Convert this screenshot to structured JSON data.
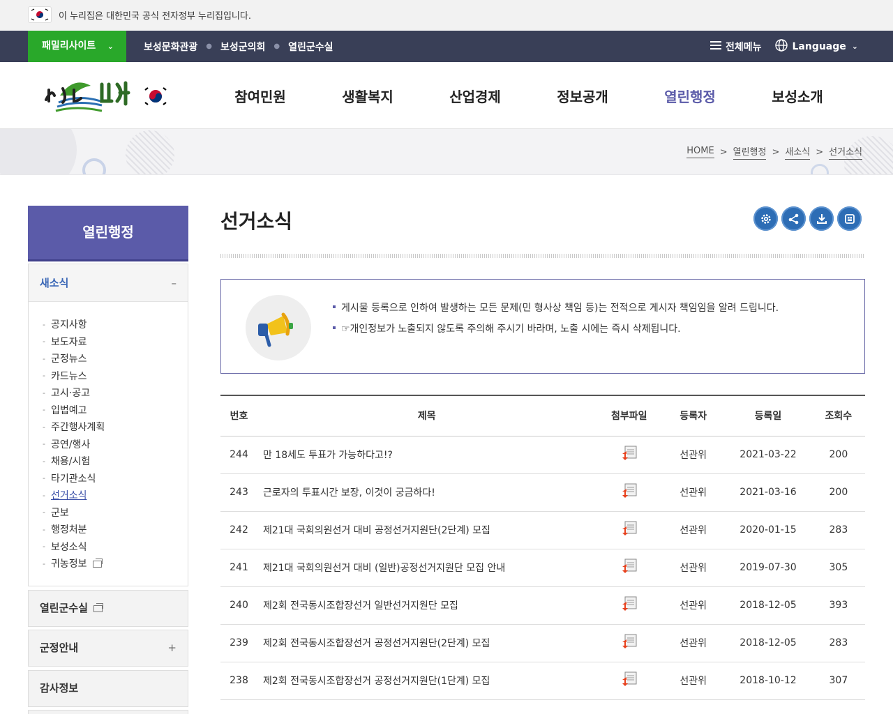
{
  "gov_banner": {
    "text": "이 누리집은 대한민국 공식 전자정부 누리집입니다."
  },
  "util": {
    "family_site": "패밀리사이트",
    "links": [
      "보성문화관광",
      "보성군의회",
      "열린군수실"
    ],
    "all_menu": "전체메뉴",
    "language": "Language"
  },
  "gnb": {
    "items": [
      "참여민원",
      "생활복지",
      "산업경제",
      "정보공개",
      "열린행정",
      "보성소개"
    ],
    "active": "열린행정"
  },
  "breadcrumb": [
    "HOME",
    "열린행정",
    "새소식",
    "선거소식"
  ],
  "sidebar": {
    "title": "열린행정",
    "section": "새소식",
    "items": [
      "공지사항",
      "보도자료",
      "군정뉴스",
      "카드뉴스",
      "고시·공고",
      "입법예고",
      "주간행사계획",
      "공연/행사",
      "채용/시험",
      "타기관소식",
      "선거소식",
      "군보",
      "행정처분",
      "보성소식",
      "귀농정보"
    ],
    "active_item": "선거소식",
    "menus": [
      "열린군수실",
      "군정안내",
      "감사정보"
    ]
  },
  "page": {
    "title": "선거소식"
  },
  "notice": [
    "게시물 등록으로 인하여 발생하는 모든 문제(민 형사상 책임 등)는 전적으로 게시자 책임임을 알려 드립니다.",
    "☞개인정보가 노출되지 않도록 주의해 주시기 바라며, 노출 시에는 즉시 삭제됩니다."
  ],
  "board": {
    "headers": [
      "번호",
      "제목",
      "첨부파일",
      "등록자",
      "등록일",
      "조회수"
    ],
    "rows": [
      {
        "no": "244",
        "title": "만 18세도 투표가 가능하다고!?",
        "writer": "선관위",
        "date": "2021-03-22",
        "views": "200"
      },
      {
        "no": "243",
        "title": "근로자의 투표시간 보장, 이것이 궁금하다!",
        "writer": "선관위",
        "date": "2021-03-16",
        "views": "200"
      },
      {
        "no": "242",
        "title": "제21대 국회의원선거 대비 공정선거지원단(2단계) 모집",
        "writer": "선관위",
        "date": "2020-01-15",
        "views": "283"
      },
      {
        "no": "241",
        "title": "제21대 국회의원선거 대비 (일반)공정선거지원단 모집 안내",
        "writer": "선관위",
        "date": "2019-07-30",
        "views": "305"
      },
      {
        "no": "240",
        "title": "제2회 전국동시조합장선거 일반선거지원단 모집",
        "writer": "선관위",
        "date": "2018-12-05",
        "views": "393"
      },
      {
        "no": "239",
        "title": "제2회 전국동시조합장선거 공정선거지원단(2단계) 모집",
        "writer": "선관위",
        "date": "2018-12-05",
        "views": "283"
      },
      {
        "no": "238",
        "title": "제2회 전국동시조합장선거 공정선거지원단(1단계) 모집",
        "writer": "선관위",
        "date": "2018-10-12",
        "views": "307"
      }
    ]
  },
  "colors": {
    "gnb_active": "#5b5ba9",
    "util_bg": "#393f57",
    "family_btn": "#29a82a",
    "tool_btn": "#2d6db5",
    "file_icon_arrow": "#e8401c"
  }
}
